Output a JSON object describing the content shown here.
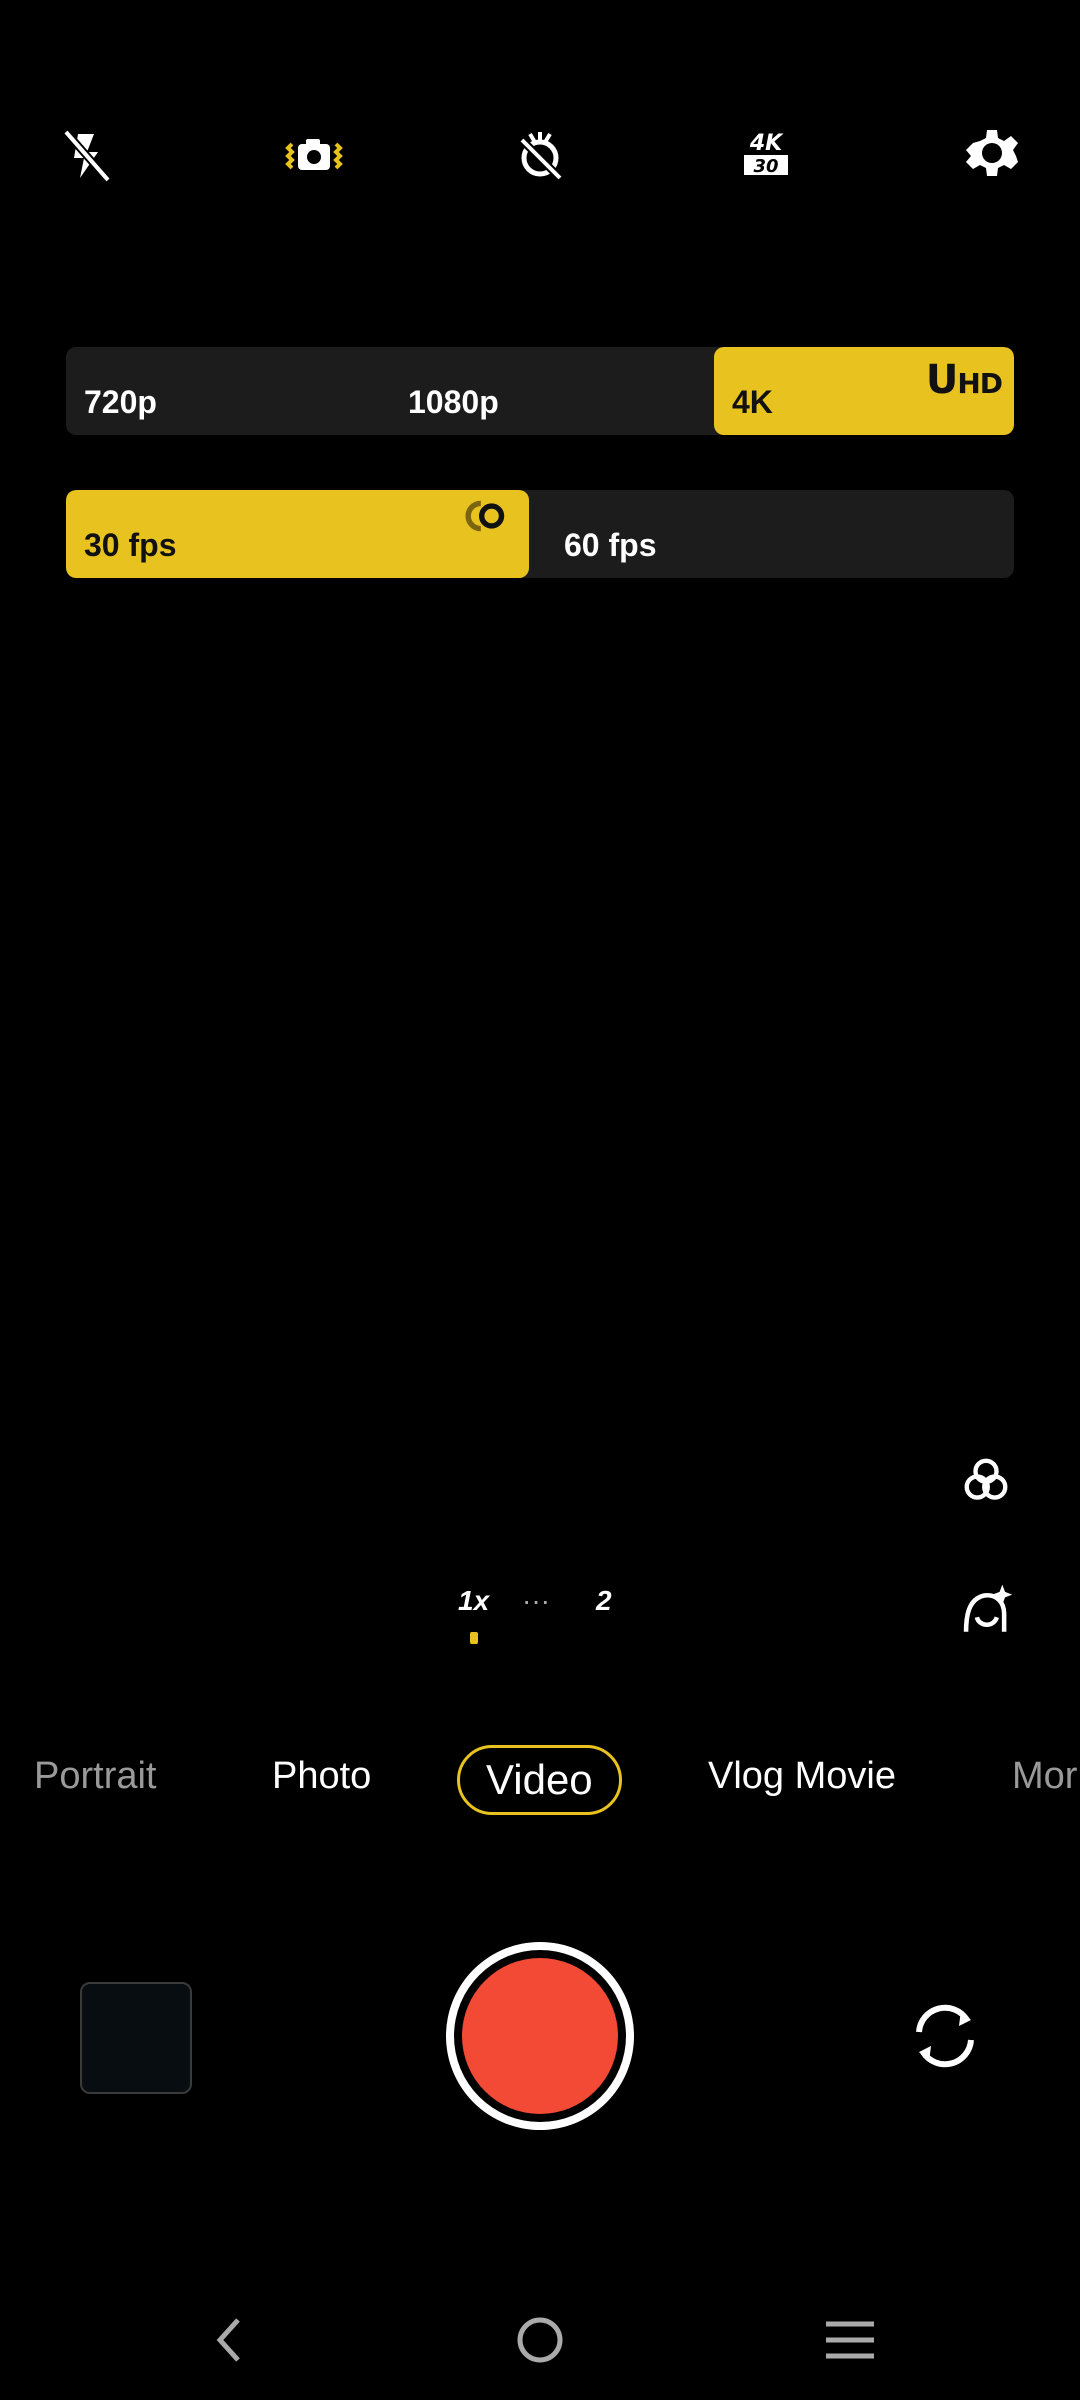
{
  "toolbar": {
    "icons": [
      "flash-off-icon",
      "stabilization-icon",
      "filter-off-icon",
      "resolution-fps-icon",
      "settings-icon"
    ],
    "res_badge_top": "4K",
    "res_badge_bottom": "30"
  },
  "resolution": {
    "options": [
      "720p",
      "1080p",
      "4K"
    ],
    "selected": "4K",
    "badge": "UHD"
  },
  "framerate": {
    "options": [
      "30 fps",
      "60 fps"
    ],
    "selected": "30 fps"
  },
  "zoom": {
    "levels": [
      "1x",
      "···",
      "2"
    ]
  },
  "modes": {
    "items": [
      "Portrait",
      "Photo",
      "Video",
      "Vlog Movie",
      "Mor"
    ],
    "selected": "Video"
  },
  "colors": {
    "accent": "#e8c21e",
    "record": "#f34a35",
    "panel": "#1c1c1c"
  }
}
